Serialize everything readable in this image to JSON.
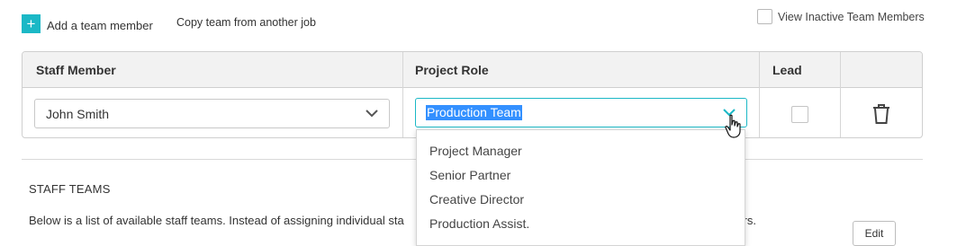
{
  "toolbar": {
    "add_icon": "+",
    "add_label": "Add a team member",
    "copy_label": "Copy team from another job",
    "inactive_label": "View Inactive Team Members",
    "accent_color": "#1bb8c6"
  },
  "table": {
    "headers": [
      "Staff Member",
      "Project Role",
      "Lead"
    ],
    "rows": [
      {
        "staff": "John Smith",
        "role": "Production Team",
        "lead": false
      }
    ]
  },
  "dropdown": {
    "options": [
      "Project Manager",
      "Senior Partner",
      "Creative Director",
      "Production Assist."
    ]
  },
  "staff_teams": {
    "title": "STAFF TEAMS",
    "description_start": "Below is a list of available staff teams. Instead of assigning individual sta",
    "description_end": "fers.",
    "edit_label": "Edit"
  },
  "icons": {
    "chevron": "chevron-down-icon",
    "trash": "trash-icon",
    "cursor": "hand-pointer-icon"
  }
}
